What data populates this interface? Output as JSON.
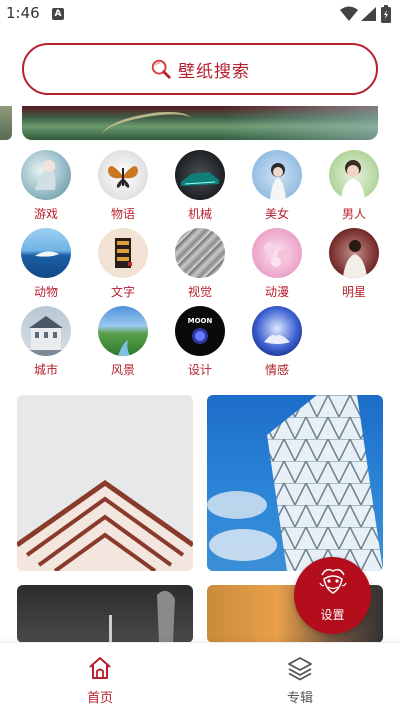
{
  "status": {
    "time": "1:46",
    "app_icon_letter": "A"
  },
  "search": {
    "label": "壁纸搜索",
    "icon": "search-icon"
  },
  "categories": [
    {
      "label": "游戏",
      "icon": "game-thumb"
    },
    {
      "label": "物语",
      "icon": "butterfly-thumb"
    },
    {
      "label": "机械",
      "icon": "car-thumb"
    },
    {
      "label": "美女",
      "icon": "girl-umbrella-thumb"
    },
    {
      "label": "男人",
      "icon": "man-thumb"
    },
    {
      "label": "动物",
      "icon": "whale-thumb"
    },
    {
      "label": "文字",
      "icon": "calligraphy-thumb"
    },
    {
      "label": "视觉",
      "icon": "abstract-thumb"
    },
    {
      "label": "动漫",
      "icon": "flower-thumb"
    },
    {
      "label": "明星",
      "icon": "star-thumb"
    },
    {
      "label": "城市",
      "icon": "building-thumb"
    },
    {
      "label": "风景",
      "icon": "landscape-thumb"
    },
    {
      "label": "设计",
      "icon": "moon-poster-thumb"
    },
    {
      "label": "情感",
      "icon": "hands-light-thumb"
    }
  ],
  "design_thumb_text": "MOON",
  "fab": {
    "label": "设置",
    "icon": "dragon-icon"
  },
  "nav": {
    "home_label": "首页",
    "albums_label": "专辑"
  },
  "colors": {
    "accent": "#b6202d",
    "fab": "#b40d1c"
  }
}
